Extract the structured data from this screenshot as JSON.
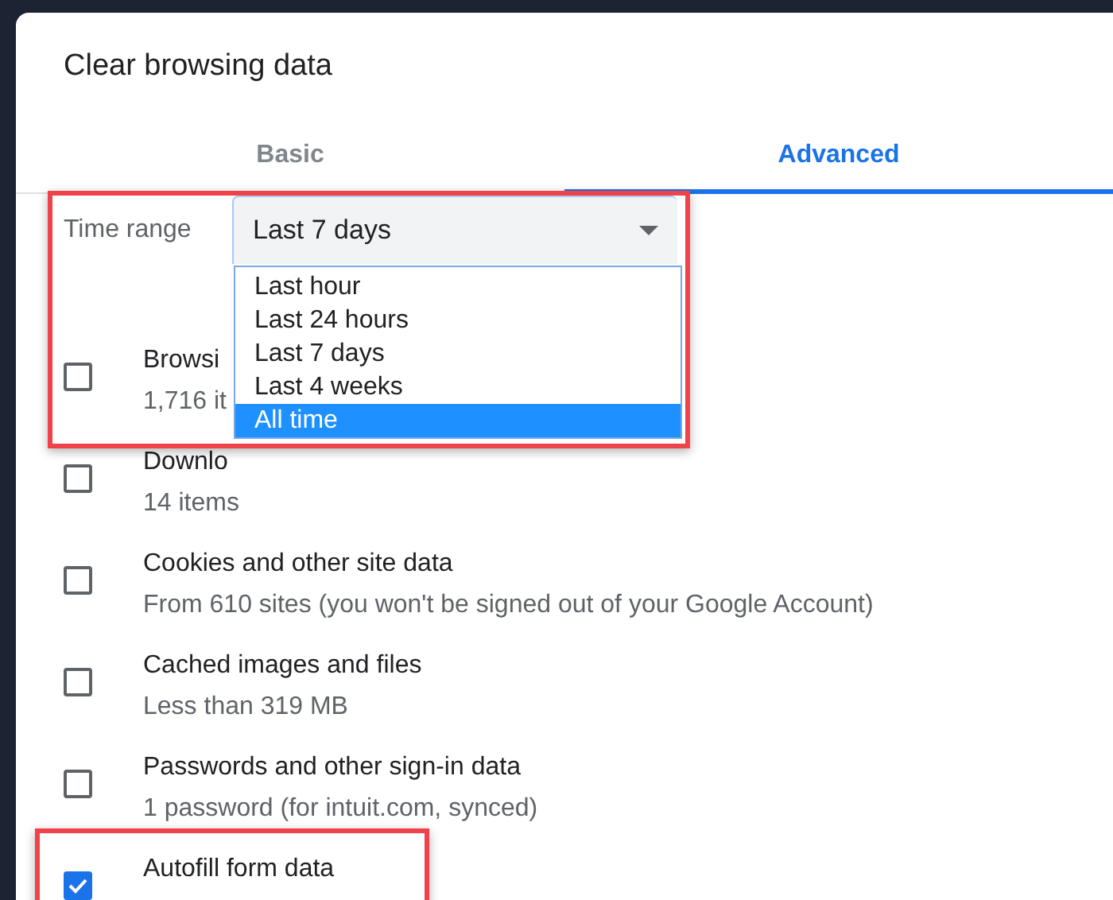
{
  "dialog": {
    "title": "Clear browsing data"
  },
  "tabs": [
    {
      "label": "Basic",
      "selected": false
    },
    {
      "label": "Advanced",
      "selected": true
    }
  ],
  "time_range": {
    "label": "Time range",
    "value": "Last 7 days",
    "highlighted": true,
    "options": [
      {
        "label": "Last hour",
        "highlighted": false
      },
      {
        "label": "Last 24 hours",
        "highlighted": false
      },
      {
        "label": "Last 7 days",
        "highlighted": false
      },
      {
        "label": "Last 4 weeks",
        "highlighted": false
      },
      {
        "label": "All time",
        "highlighted": true
      }
    ]
  },
  "items": [
    {
      "title": "Browsi",
      "detail": "1,716 it",
      "checked": false,
      "highlighted": false
    },
    {
      "title": "Downlo",
      "detail": "14 items",
      "checked": false,
      "highlighted": false
    },
    {
      "title": "Cookies and other site data",
      "detail": "From 610 sites (you won't be signed out of your Google Account)",
      "checked": false,
      "highlighted": false
    },
    {
      "title": "Cached images and files",
      "detail": "Less than 319 MB",
      "checked": false,
      "highlighted": false
    },
    {
      "title": "Passwords and other sign-in data",
      "detail": "1 password (for intuit.com, synced)",
      "checked": false,
      "highlighted": false
    },
    {
      "title": "Autofill form data",
      "checked": true,
      "highlighted": true
    }
  ]
}
